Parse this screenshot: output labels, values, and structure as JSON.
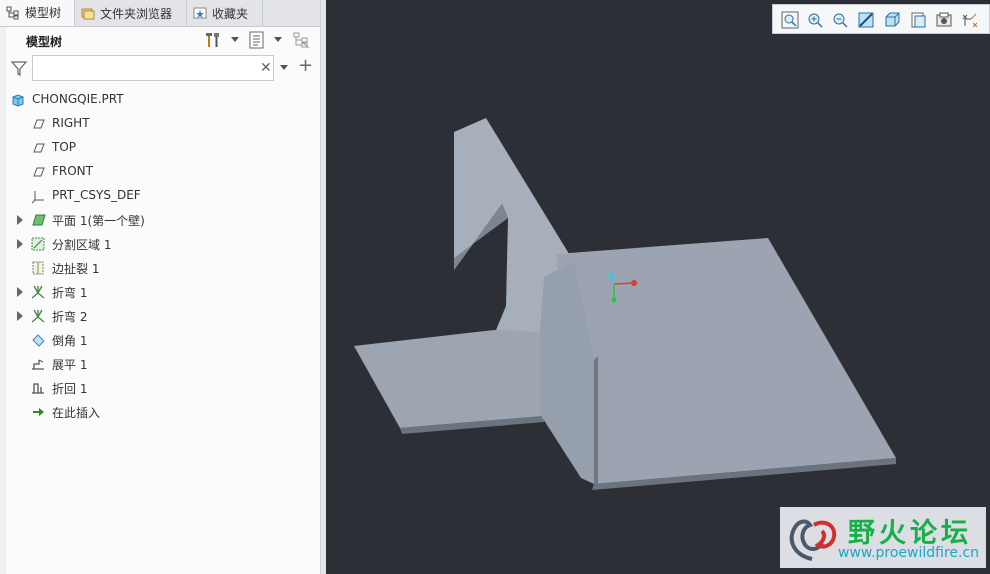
{
  "tabs": [
    {
      "label": "模型树",
      "icon": "tree-icon",
      "active": true
    },
    {
      "label": "文件夹浏览器",
      "icon": "folder-icon",
      "active": false
    },
    {
      "label": "收藏夹",
      "icon": "favorites-icon",
      "active": false
    }
  ],
  "panel": {
    "title": "模型树",
    "search": {
      "value": "",
      "placeholder": ""
    }
  },
  "tree": [
    {
      "label": "CHONGQIE.PRT",
      "icon": "part-icon",
      "expandable": false,
      "level": 0
    },
    {
      "label": "RIGHT",
      "icon": "datum-plane-icon",
      "expandable": false,
      "level": 1
    },
    {
      "label": "TOP",
      "icon": "datum-plane-icon",
      "expandable": false,
      "level": 1
    },
    {
      "label": "FRONT",
      "icon": "datum-plane-icon",
      "expandable": false,
      "level": 1
    },
    {
      "label": "PRT_CSYS_DEF",
      "icon": "csys-icon",
      "expandable": false,
      "level": 1
    },
    {
      "label": "平面 1(第一个壁)",
      "icon": "flat-wall-icon",
      "expandable": true,
      "level": 1
    },
    {
      "label": "分割区域 1",
      "icon": "split-area-icon",
      "expandable": true,
      "level": 1
    },
    {
      "label": "边扯裂 1",
      "icon": "edge-rip-icon",
      "expandable": false,
      "level": 1
    },
    {
      "label": "折弯 1",
      "icon": "bend-icon",
      "expandable": true,
      "level": 1
    },
    {
      "label": "折弯 2",
      "icon": "bend-icon",
      "expandable": true,
      "level": 1
    },
    {
      "label": "倒角 1",
      "icon": "chamfer-icon",
      "expandable": false,
      "level": 1
    },
    {
      "label": "展平 1",
      "icon": "unbend-icon",
      "expandable": false,
      "level": 1
    },
    {
      "label": "折回 1",
      "icon": "bend-back-icon",
      "expandable": false,
      "level": 1
    },
    {
      "label": "在此插入",
      "icon": "insert-here-icon",
      "expandable": false,
      "level": 1
    }
  ],
  "viewport_toolbar": [
    "zoom-fit-icon",
    "zoom-in-icon",
    "zoom-out-icon",
    "repaint-icon",
    "display-style-icon",
    "saved-views-icon",
    "view-manager-icon",
    "datum-display-icon"
  ],
  "watermark": {
    "title": "野火论坛",
    "url": "www.proewildfire.cn"
  },
  "colors": {
    "viewport_bg": "#2d2f37",
    "part_surface": "#9aa3b0",
    "accent_green": "#16b04a"
  }
}
